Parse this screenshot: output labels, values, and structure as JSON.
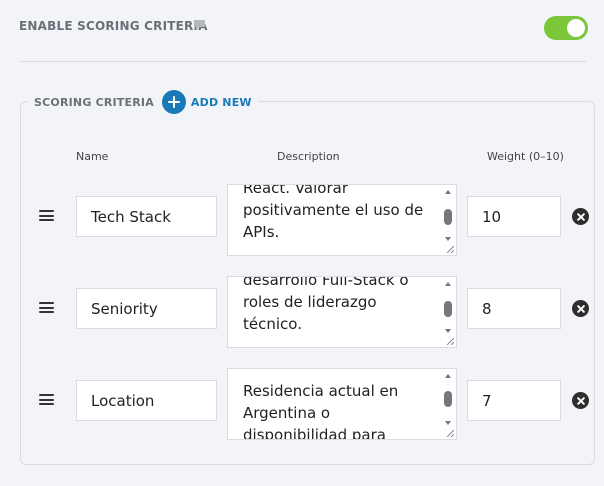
{
  "enable": {
    "label": "ENABLE SCORING CRITERIA",
    "enabled": true,
    "accent": "#7bc639"
  },
  "criteria": {
    "title": "SCORING CRITERIA",
    "add_label": "ADD NEW",
    "accent": "#1a7ab8",
    "columns": {
      "name": "Name",
      "description": "Description",
      "weight": "Weight (0–10)"
    },
    "rows": [
      {
        "name": "Tech Stack",
        "description_lines": [
          "React. Valorar",
          "positivamente el uso de",
          "APIs."
        ],
        "weight": "10"
      },
      {
        "name": "Seniority",
        "description_lines": [
          "desarrollo Full-Stack o",
          "roles de liderazgo",
          "técnico."
        ],
        "weight": "8"
      },
      {
        "name": "Location",
        "description_lines": [
          "Residencia actual en",
          "Argentina o",
          "disponibilidad para"
        ],
        "weight": "7"
      }
    ]
  },
  "icons": {
    "comment": "comment-icon",
    "drag": "drag-handle-icon",
    "remove": "close-circle-icon",
    "add": "plus-circle-icon"
  }
}
